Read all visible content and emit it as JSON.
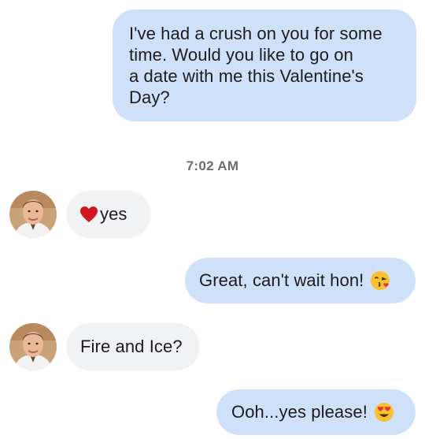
{
  "conversation": {
    "messages": [
      {
        "direction": "sent",
        "text": "I've had a crush on you for some\ntime. Would you like to go on\na date with me this Valentine's\nDay?"
      },
      {
        "direction": "received",
        "text": "yes",
        "prefix_icon": "red-heart-emoji-icon"
      },
      {
        "direction": "sent",
        "text": "Great, can't wait hon!",
        "suffix_icon": "kissing-face-emoji-icon"
      },
      {
        "direction": "received",
        "text": "Fire and Ice?"
      },
      {
        "direction": "sent",
        "text": "Ooh...yes please!",
        "suffix_icon": "heart-eyes-emoji-icon"
      }
    ],
    "timestamp": "7:02 AM"
  },
  "colors": {
    "sent_bubble": "#cfe0f9",
    "received_bubble": "#f1f2f4",
    "text": "#1c1c1e",
    "timestamp": "#6d6d70"
  }
}
